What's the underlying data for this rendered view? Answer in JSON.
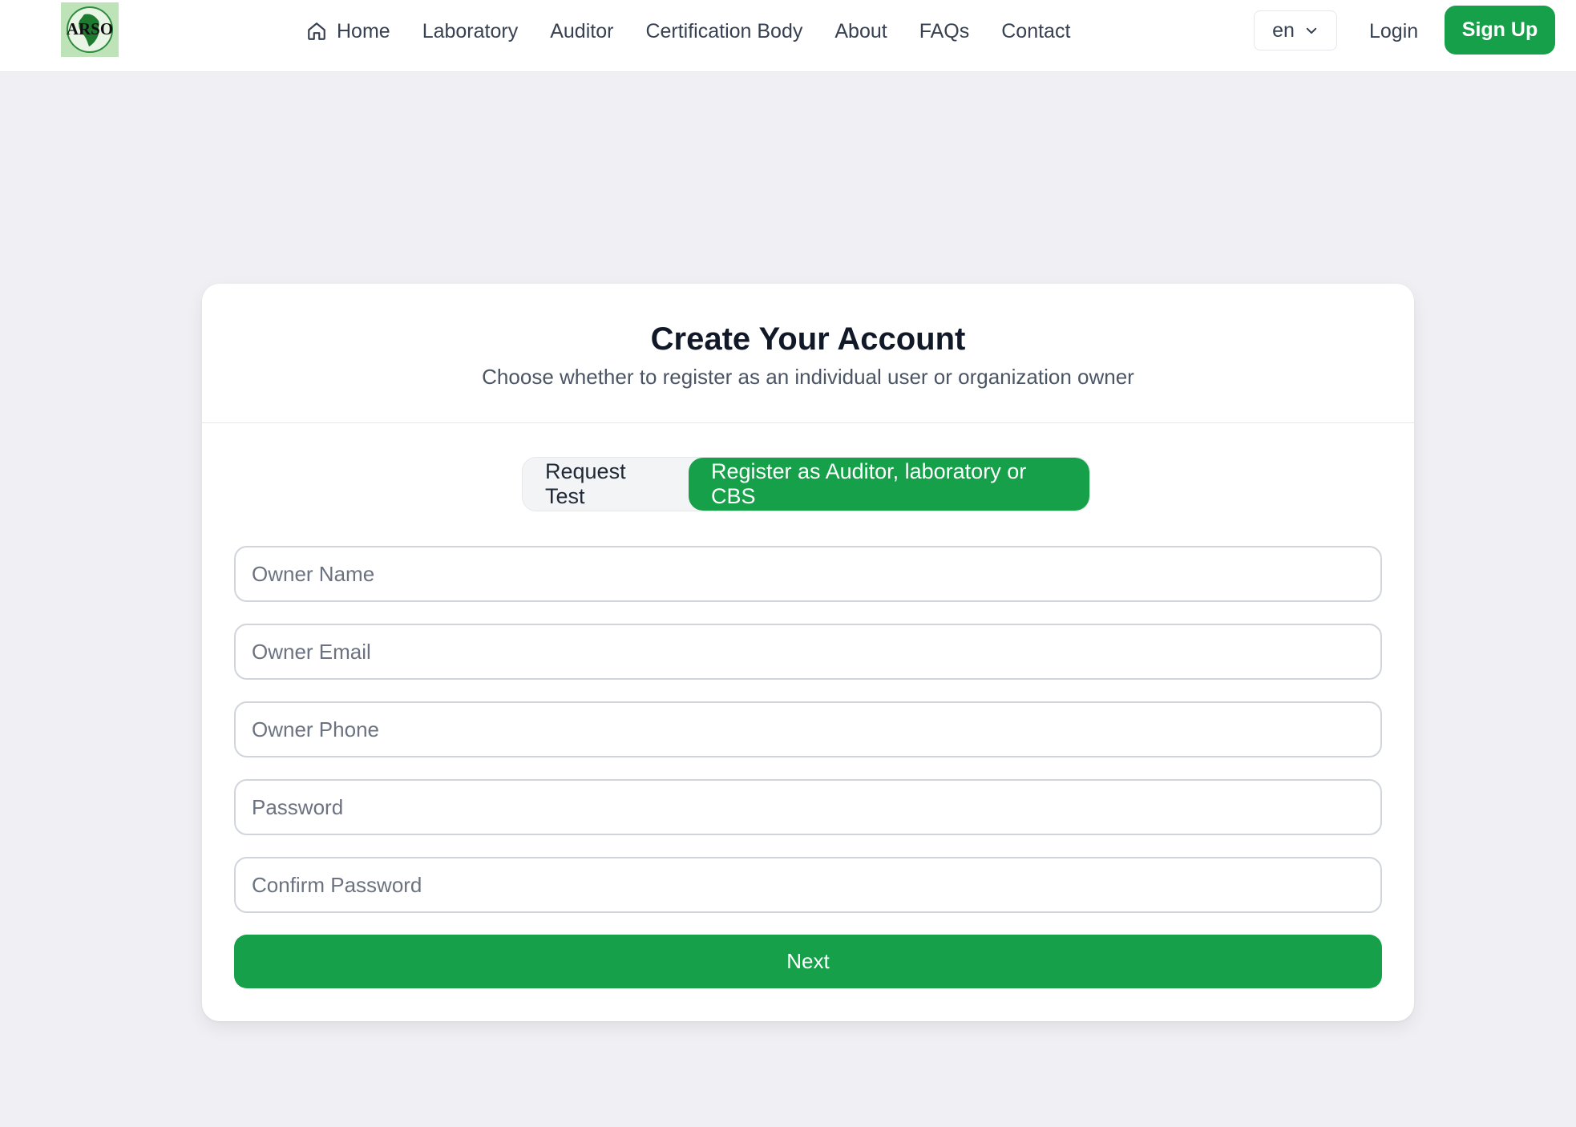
{
  "header": {
    "logo_text": "ARSO",
    "nav": [
      {
        "label": "Home",
        "icon": "home-icon"
      },
      {
        "label": "Laboratory"
      },
      {
        "label": "Auditor"
      },
      {
        "label": "Certification Body"
      },
      {
        "label": "About"
      },
      {
        "label": "FAQs"
      },
      {
        "label": "Contact"
      }
    ],
    "language": "en",
    "login_label": "Login",
    "signup_label": "Sign Up"
  },
  "card": {
    "title": "Create Your Account",
    "subtitle": "Choose whether to register as an individual user or organization owner",
    "toggle": {
      "options": [
        "Request Test",
        "Register as Auditor, laboratory or CBS"
      ],
      "selected": "Register as Auditor, laboratory or CBS"
    },
    "fields": [
      {
        "placeholder": "Owner Name",
        "value": ""
      },
      {
        "placeholder": "Owner Email",
        "value": ""
      },
      {
        "placeholder": "Owner Phone",
        "value": ""
      },
      {
        "placeholder": "Password",
        "value": ""
      },
      {
        "placeholder": "Confirm Password",
        "value": ""
      }
    ],
    "next_label": "Next"
  },
  "colors": {
    "accent": "#17a04a",
    "background": "#f0f0f4",
    "card": "#ffffff"
  }
}
